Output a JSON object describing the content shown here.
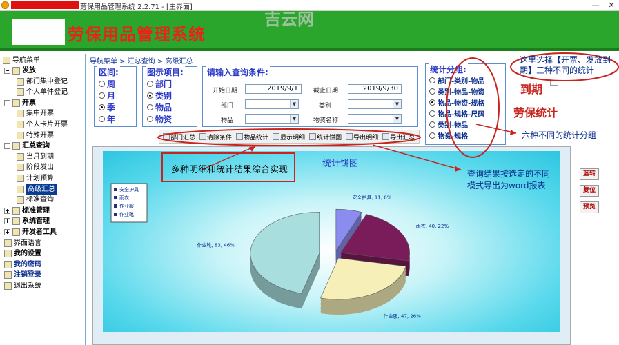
{
  "window": {
    "title": "劳保用品管理系统 2.2.71 - [主界面]",
    "watermark": "吉云网",
    "minimize": "—",
    "close": "✕"
  },
  "banner": {
    "app_title": "劳保用品管理系统"
  },
  "sidebar": {
    "root": "导航菜单",
    "items": [
      {
        "label": "发放",
        "level": 0,
        "expanded": "−"
      },
      {
        "label": "部门集中登记",
        "level": 1
      },
      {
        "label": "个人单件登记",
        "level": 1
      },
      {
        "label": "开票",
        "level": 0,
        "expanded": "−"
      },
      {
        "label": "集中开票",
        "level": 1
      },
      {
        "label": "个人卡片开票",
        "level": 1
      },
      {
        "label": "特殊开票",
        "level": 1
      },
      {
        "label": "汇总查询",
        "level": 0,
        "expanded": "−"
      },
      {
        "label": "当月到期",
        "level": 1
      },
      {
        "label": "阶段发出",
        "level": 1
      },
      {
        "label": "计划预算",
        "level": 1
      },
      {
        "label": "高级汇总",
        "level": 1,
        "selected": true
      },
      {
        "label": "标准查询",
        "level": 1
      },
      {
        "label": "标准管理",
        "level": 0,
        "expanded": "+"
      },
      {
        "label": "系统管理",
        "level": 0,
        "expanded": "+"
      },
      {
        "label": "开发者工具",
        "level": 0,
        "expanded": "+"
      },
      {
        "label": "界面语言",
        "level": 0
      },
      {
        "label": "我的设置",
        "level": 0
      },
      {
        "label": "我的密码",
        "level": 0
      },
      {
        "label": "注销登录",
        "level": 0
      },
      {
        "label": "退出系统",
        "level": 0
      }
    ]
  },
  "breadcrumb": "导航菜单 > 汇总查询 > 高级汇总",
  "interval": {
    "title": "区间:",
    "options": [
      "周",
      "月",
      "季",
      "年"
    ],
    "selected": "季"
  },
  "display_item": {
    "title": "图示项目:",
    "options": [
      "部门",
      "类别",
      "物品",
      "物资"
    ],
    "selected": "类别"
  },
  "query": {
    "title": "请输入查询条件:",
    "start_date_label": "开始日期",
    "start_date": "2019/9/1",
    "end_date_label": "截止日期",
    "end_date": "2019/9/30",
    "department_label": "部门",
    "category_label": "类别",
    "item_label": "物品",
    "material_name_label": "物资名称",
    "dropdown_arrow": "▼"
  },
  "stat_group": {
    "title": "统计分组:",
    "options": [
      "部门-类别-物品",
      "类别-物品-物资",
      "物品-物资-规格",
      "物品-规格-尺码",
      "类别-物品",
      "物资-规格"
    ],
    "selected": "物品-物资-规格"
  },
  "toolbar": {
    "buttons": [
      "部门汇总",
      "清除条件",
      "物品统计",
      "显示明细",
      "统计饼图",
      "导出明细",
      "导出汇总"
    ]
  },
  "side_buttons": [
    "蓝转",
    "复位",
    "预览"
  ],
  "chart_data": {
    "type": "pie",
    "title": "统计饼图",
    "legend": [
      "安全护具",
      "雨衣",
      "作业服",
      "作业靴"
    ],
    "legend_placement": "top-left",
    "slices": [
      {
        "name": "安全护具",
        "value": 11,
        "percent": 6,
        "label": "安全护具, 11, 6%",
        "color": "#8a8cf0"
      },
      {
        "name": "雨衣",
        "value": 40,
        "percent": 22,
        "label": "雨衣, 40, 22%",
        "color": "#7b1c5a"
      },
      {
        "name": "作业服",
        "value": 47,
        "percent": 26,
        "label": "作业服, 47, 26%",
        "color": "#f6f0b8"
      },
      {
        "name": "作业靴",
        "value": 83,
        "percent": 46,
        "label": "作业靴, 83, 46%",
        "color": "#a8dede"
      }
    ]
  },
  "annotations": {
    "top_right": "这里选择【开票、发放到期】三种不同的统计",
    "top_right_tail": "到期",
    "labor_stats": "劳保统计",
    "six_groups": "六种不同的统计分组",
    "multi_detail": "多种明细和统计结果综合实现",
    "export_note_1": "查询结果按选定的不同",
    "export_note_2": "模式导出为word报表"
  },
  "colors": {
    "banner_green": "#29a62b",
    "title_red": "#e8241a",
    "accent_blue": "#2a39c8",
    "annotation_red": "#c8231c"
  }
}
